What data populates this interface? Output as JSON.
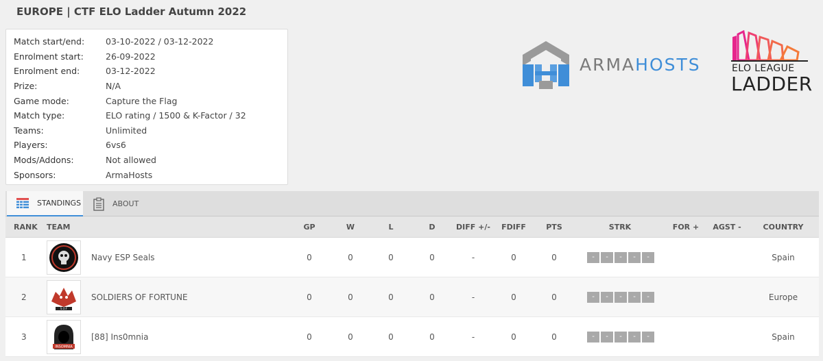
{
  "page": {
    "title": "EUROPE | CTF ELO Ladder Autumn 2022"
  },
  "info": [
    {
      "label": "Match start/end:",
      "value": "03-10-2022 / 03-12-2022"
    },
    {
      "label": "Enrolment start:",
      "value": "26-09-2022"
    },
    {
      "label": "Enrolment end:",
      "value": "03-12-2022"
    },
    {
      "label": "Prize:",
      "value": "N/A"
    },
    {
      "label": "Game mode:",
      "value": "Capture the Flag"
    },
    {
      "label": "Match type:",
      "value": "ELO rating / 1500 & K-Factor / 32"
    },
    {
      "label": "Teams:",
      "value": "Unlimited"
    },
    {
      "label": "Players:",
      "value": "6vs6"
    },
    {
      "label": "Mods/Addons:",
      "value": "Not allowed"
    },
    {
      "label": "Sponsors:",
      "value": "ArmaHosts"
    }
  ],
  "sponsor_logo": {
    "prefix": "ARMA",
    "suffix": "HOSTS",
    "accent": "#3f8ed8"
  },
  "league_logo": {
    "line1": "ELO LEAGUE",
    "line2": "LADDER",
    "accent": "#e6268c"
  },
  "tabs": [
    {
      "label": "STANDINGS",
      "icon": "standings-icon",
      "active": true
    },
    {
      "label": "ABOUT",
      "icon": "clipboard-icon",
      "active": false
    }
  ],
  "table": {
    "headers": {
      "rank": "RANK",
      "team": "TEAM",
      "gp": "GP",
      "w": "W",
      "l": "L",
      "d": "D",
      "diff": "DIFF +/-",
      "fdiff": "FDIFF",
      "pts": "PTS",
      "strk": "STRK",
      "for": "FOR +",
      "agst": "AGST -",
      "country": "COUNTRY"
    },
    "rows": [
      {
        "rank": "1",
        "team": "Navy ESP Seals",
        "gp": "0",
        "w": "0",
        "l": "0",
        "d": "0",
        "diff": "-",
        "fdiff": "0",
        "pts": "0",
        "streak": [
          "-",
          "-",
          "-",
          "-",
          "-"
        ],
        "for": "",
        "agst": "",
        "country": "Spain"
      },
      {
        "rank": "2",
        "team": "SOLDIERS OF FORTUNE",
        "gp": "0",
        "w": "0",
        "l": "0",
        "d": "0",
        "diff": "-",
        "fdiff": "0",
        "pts": "0",
        "streak": [
          "-",
          "-",
          "-",
          "-",
          "-"
        ],
        "for": "",
        "agst": "",
        "country": "Europe"
      },
      {
        "rank": "3",
        "team": "[88] Ins0mnia",
        "gp": "0",
        "w": "0",
        "l": "0",
        "d": "0",
        "diff": "-",
        "fdiff": "0",
        "pts": "0",
        "streak": [
          "-",
          "-",
          "-",
          "-",
          "-"
        ],
        "for": "",
        "agst": "",
        "country": "Spain"
      }
    ]
  },
  "colors": {
    "accent": "#3f8ed8",
    "streak": "#a9a9a9"
  }
}
